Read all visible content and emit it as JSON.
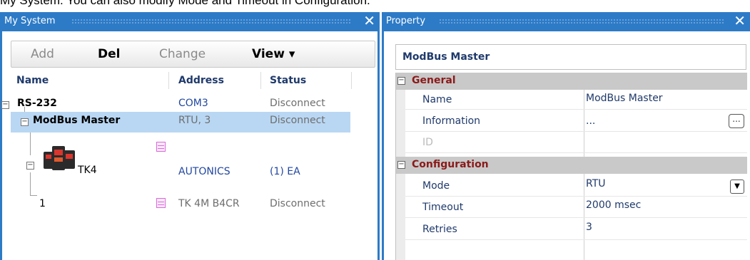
{
  "caption": "My System. You can also modify Mode and Timeout in Configuration.",
  "my_system": {
    "title": "My System",
    "toolbar": {
      "add": "Add",
      "del": "Del",
      "change": "Change",
      "view": "View ▾"
    },
    "columns": {
      "name": "Name",
      "address": "Address",
      "status": "Status"
    },
    "rows": [
      {
        "name": "RS-232",
        "address": "COM3",
        "status": "Disconnect"
      },
      {
        "name": "ModBus Master",
        "address": "RTU, 3",
        "status": "Disconnect"
      },
      {
        "name": "TK4",
        "address": "AUTONICS",
        "status": "(1) EA"
      },
      {
        "name": "1",
        "address": "TK 4M B4CR",
        "status": "Disconnect"
      }
    ]
  },
  "property": {
    "title": "Property",
    "header": "ModBus Master",
    "general": {
      "label": "General",
      "name_label": "Name",
      "name_value": "ModBus Master",
      "info_label": "Information",
      "info_value": "...",
      "id_label": "ID"
    },
    "configuration": {
      "label": "Configuration",
      "mode_label": "Mode",
      "mode_value": "RTU",
      "timeout_label": "Timeout",
      "timeout_value": "2000 msec",
      "retries_label": "Retries",
      "retries_value": "3"
    }
  },
  "icons": {
    "close": "✕",
    "ellipsis": "...",
    "dropdown": "▼",
    "minus": "−"
  }
}
